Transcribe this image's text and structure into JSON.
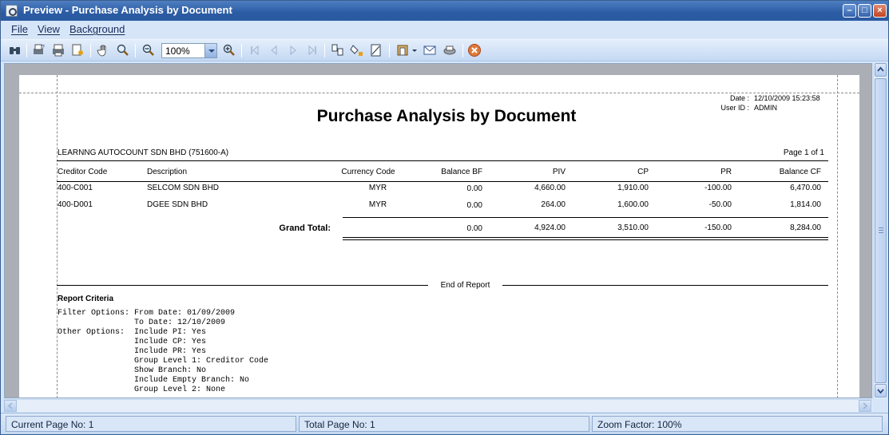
{
  "window": {
    "title": "Preview - Purchase Analysis by Document"
  },
  "menu": {
    "file": "File",
    "view": "View",
    "background": "Background"
  },
  "toolbar": {
    "zoom_value": "100%"
  },
  "report": {
    "date_label": "Date :",
    "date_value": "12/10/2009 15:23:58",
    "user_label": "User ID :",
    "user_value": "ADMIN",
    "title": "Purchase Analysis by Document",
    "company": "LEARNNG AUTOCOUNT SDN BHD (751600-A)",
    "page_info": "Page 1 of 1",
    "columns": {
      "creditor_code": "Creditor Code",
      "description": "Description",
      "currency_code": "Currency Code",
      "balance_bf": "Balance BF",
      "piv": "PIV",
      "cp": "CP",
      "pr": "PR",
      "balance_cf": "Balance CF"
    },
    "rows": [
      {
        "creditor_code": "400-C001",
        "description": "SELCOM SDN BHD",
        "currency": "MYR",
        "balance_bf": "0.00",
        "piv": "4,660.00",
        "cp": "1,910.00",
        "pr": "-100.00",
        "balance_cf": "6,470.00"
      },
      {
        "creditor_code": "400-D001",
        "description": "DGEE SDN BHD",
        "currency": "MYR",
        "balance_bf": "0.00",
        "piv": "264.00",
        "cp": "1,600.00",
        "pr": "-50.00",
        "balance_cf": "1,814.00"
      }
    ],
    "grand_total": {
      "label": "Grand Total:",
      "balance_bf": "0.00",
      "piv": "4,924.00",
      "cp": "3,510.00",
      "pr": "-150.00",
      "balance_cf": "8,284.00"
    },
    "end_of_report": "End of Report",
    "criteria_title": "Report Criteria",
    "criteria_lines": [
      "Filter Options: From Date: 01/09/2009",
      "                To Date: 12/10/2009",
      "Other Options:  Include PI: Yes",
      "                Include CP: Yes",
      "                Include PR: Yes",
      "                Group Level 1: Creditor Code",
      "                Show Branch: No",
      "                Include Empty Branch: No",
      "                Group Level 2: None"
    ]
  },
  "status": {
    "current_page": "Current Page No: 1",
    "total_page": "Total Page No: 1",
    "zoom_factor": "Zoom Factor: 100%"
  }
}
